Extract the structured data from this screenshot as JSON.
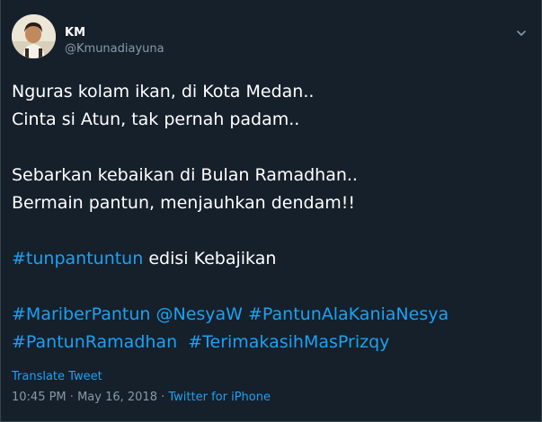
{
  "user": {
    "display_name": "KM",
    "handle": "@Kmunadiayuna"
  },
  "icons": {
    "avatar": "profile-photo",
    "caret": "chevron-down-icon"
  },
  "tweet": {
    "line1": "Nguras kolam ikan, di Kota Medan..",
    "line2": "Cinta si Atun, tak pernah padam..",
    "line3": "Sebarkan kebaikan di Bulan Ramadhan..",
    "line4": "Bermain pantun, menjauhkan dendam!!",
    "hashtag_main": "#tunpantuntun",
    "edition_text": " edisi Kebajikan",
    "tag1": "#MariberPantun",
    "mention": "@NesyaW",
    "tag2": "#PantunAlaKaniaNesya",
    "tag3": "#PantunRamadhan",
    "tag4": "#TerimakasihMasPrizqy"
  },
  "translate_label": "Translate Tweet",
  "meta": {
    "time": "10:45 PM",
    "separator": " · ",
    "date": "May 16, 2018",
    "source": "Twitter for iPhone"
  },
  "colors": {
    "background": "#15202b",
    "link": "#1da1f2",
    "secondary_text": "#8899a6"
  }
}
